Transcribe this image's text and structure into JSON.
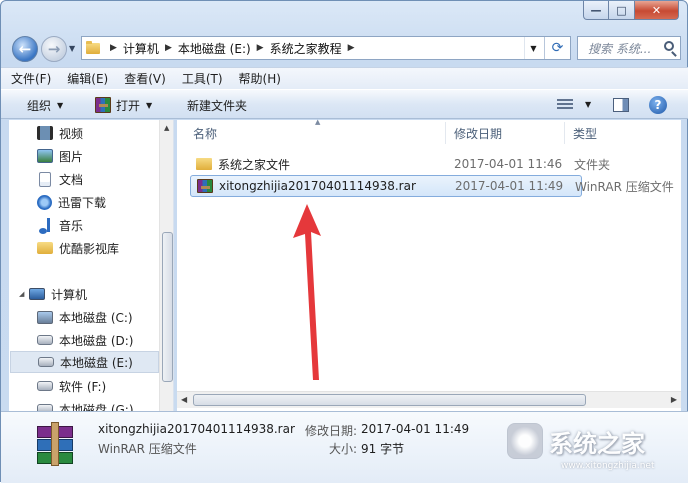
{
  "window": {
    "caption": {
      "minimize": "—",
      "maximize": "□",
      "close": "✕"
    }
  },
  "nav": {
    "back": "←",
    "forward": "→",
    "breadcrumbs": [
      "计算机",
      "本地磁盘 (E:)",
      "系统之家教程"
    ],
    "search_placeholder": "搜索 系统..."
  },
  "menubar": [
    "文件(F)",
    "编辑(E)",
    "查看(V)",
    "工具(T)",
    "帮助(H)"
  ],
  "toolbar": {
    "organize": "组织",
    "open": "打开",
    "new_folder": "新建文件夹",
    "help": "?"
  },
  "sidebar": {
    "items": [
      {
        "label": "视频",
        "icon": "video-icon"
      },
      {
        "label": "图片",
        "icon": "picture-icon"
      },
      {
        "label": "文档",
        "icon": "document-icon"
      },
      {
        "label": "迅雷下载",
        "icon": "xunlei-icon"
      },
      {
        "label": "音乐",
        "icon": "music-icon"
      },
      {
        "label": "优酷影视库",
        "icon": "folder-icon"
      }
    ],
    "computer": {
      "label": "计算机"
    },
    "drives": [
      {
        "label": "本地磁盘 (C:)",
        "selected": false
      },
      {
        "label": "本地磁盘 (D:)",
        "selected": false
      },
      {
        "label": "本地磁盘 (E:)",
        "selected": true
      },
      {
        "label": "软件 (F:)",
        "selected": false
      },
      {
        "label": "本地磁盘 (G:)",
        "selected": false
      }
    ]
  },
  "content": {
    "columns": {
      "name": "名称",
      "date": "修改日期",
      "type": "类型"
    },
    "rows": [
      {
        "name": "系统之家文件",
        "date": "2017-04-01 11:46",
        "type": "文件夹",
        "icon": "folder-icon",
        "selected": false
      },
      {
        "name": "xitongzhijia20170401114938.rar",
        "date": "2017-04-01 11:49",
        "type": "WinRAR 压缩文件",
        "icon": "rar-icon",
        "selected": true
      }
    ]
  },
  "details": {
    "name": "xitongzhijia20170401114938.rar",
    "type": "WinRAR 压缩文件",
    "modified_label": "修改日期:",
    "modified_value": "2017-04-01 11:49",
    "size_label": "大小:",
    "size_value": "91 字节"
  },
  "watermark": {
    "text": "系统之家",
    "url": "www.xitongzhijia.net"
  },
  "colors": {
    "selection_border": "#84acdd",
    "selection_fill": "#d4e6fa",
    "arrow": "#e5383b"
  }
}
